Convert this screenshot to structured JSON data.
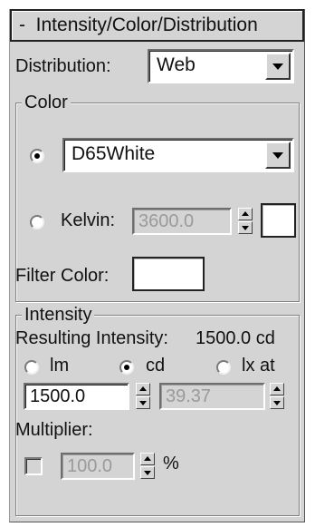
{
  "rollout": {
    "collapse_symbol": "-",
    "title": "Intensity/Color/Distribution"
  },
  "distribution": {
    "label": "Distribution:",
    "value": "Web"
  },
  "color_group": {
    "title": "Color",
    "preset_value": "D65White",
    "preset_selected": true,
    "kelvin_label": "Kelvin:",
    "kelvin_value": "3600.0",
    "kelvin_selected": false,
    "kelvin_swatch_color": "#ffffff",
    "filter_label": "Filter Color:",
    "filter_swatch_color": "#ffffff"
  },
  "intensity_group": {
    "title": "Intensity",
    "resulting_label": "Resulting Intensity:",
    "resulting_value": "1500.0 cd",
    "units": [
      {
        "label": "lm",
        "selected": false
      },
      {
        "label": "cd",
        "selected": true
      },
      {
        "label": "lx at",
        "selected": false
      }
    ],
    "value": "1500.0",
    "distance": "39.37",
    "multiplier_label": "Multiplier:",
    "multiplier_enabled": false,
    "multiplier_value": "100.0",
    "multiplier_unit": "%"
  }
}
